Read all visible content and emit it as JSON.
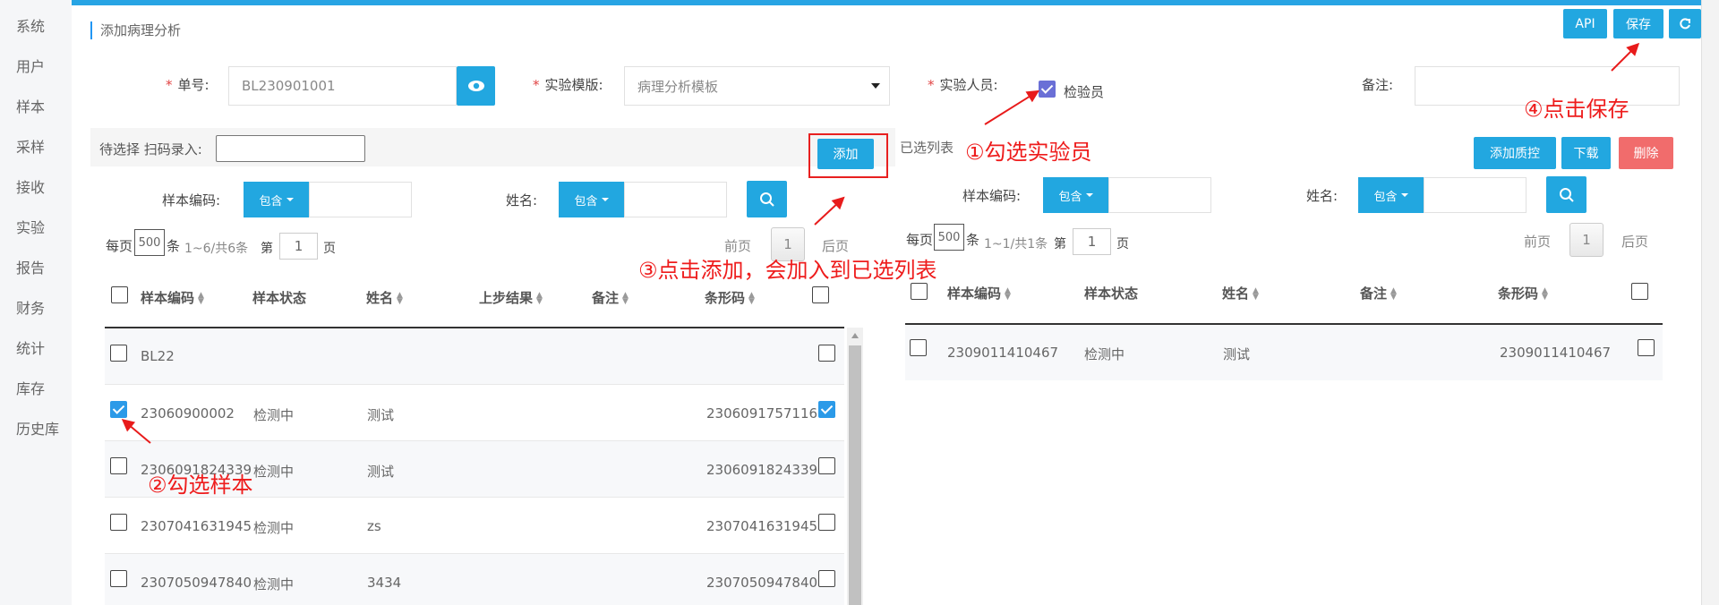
{
  "sidebar": {
    "items": [
      "系统",
      "用户",
      "样本",
      "采样",
      "接收",
      "实验",
      "报告",
      "财务",
      "统计",
      "库存",
      "历史库"
    ]
  },
  "page_title": "添加病理分析",
  "toolbar": {
    "api": "API",
    "save": "保存",
    "refresh_icon": "refresh-icon"
  },
  "form": {
    "order_no_label": "单号:",
    "order_no_value": "BL230901001",
    "template_label": "实验模版:",
    "template_value": "病理分析模板",
    "personnel_label": "实验人员:",
    "personnel_option": "检验员",
    "remark_label": "备注:",
    "remark_value": ""
  },
  "left": {
    "pending_label": "待选择 扫码录入:",
    "scan_value": "",
    "add_button": "添加",
    "filter": {
      "code_label": "样本编码:",
      "name_label": "姓名:",
      "mode": "包含"
    },
    "pager": {
      "per_page_prefix": "每页",
      "per_page_value": "500",
      "per_page_suffix": "条",
      "range": "1~6/共6条",
      "page_prefix": "第",
      "page_value": "1",
      "page_suffix": "页",
      "prev": "前页",
      "current": "1",
      "next": "后页"
    },
    "columns": [
      "样本编码",
      "样本状态",
      "姓名",
      "上步结果",
      "备注",
      "条形码"
    ],
    "rows": [
      {
        "code": "BL22",
        "status": "",
        "name": "",
        "barcode": "",
        "checked": false
      },
      {
        "code": "23060900002",
        "status": "检测中",
        "name": "测试",
        "barcode": "2306091757116",
        "checked": true
      },
      {
        "code": "2306091824339",
        "status": "检测中",
        "name": "测试",
        "barcode": "2306091824339",
        "checked": false
      },
      {
        "code": "2307041631945",
        "status": "检测中",
        "name": "zs",
        "barcode": "2307041631945",
        "checked": false
      },
      {
        "code": "2307050947840",
        "status": "检测中",
        "name": "3434",
        "barcode": "2307050947840",
        "checked": false
      }
    ]
  },
  "right": {
    "selected_label": "已选列表",
    "add_qc": "添加质控",
    "download": "下载",
    "delete": "删除",
    "filter": {
      "code_label": "样本编码:",
      "name_label": "姓名:",
      "mode": "包含"
    },
    "pager": {
      "per_page_prefix": "每页",
      "per_page_value": "500",
      "per_page_suffix": "条",
      "range": "1~1/共1条",
      "page_prefix": "第",
      "page_value": "1",
      "page_suffix": "页",
      "prev": "前页",
      "current": "1",
      "next": "后页"
    },
    "columns": [
      "样本编码",
      "样本状态",
      "姓名",
      "备注",
      "条形码"
    ],
    "rows": [
      {
        "code": "2309011410467",
        "status": "检测中",
        "name": "测试",
        "barcode": "2309011410467"
      }
    ]
  },
  "annotations": {
    "step1": "①勾选实验员",
    "step2": "②勾选样本",
    "step3": "③点击添加，会加入到已选列表",
    "step4": "④点击保存"
  },
  "colors": {
    "accent": "#22a7e0",
    "danger": "#f16c6c",
    "annotation": "#ee1c1c"
  }
}
